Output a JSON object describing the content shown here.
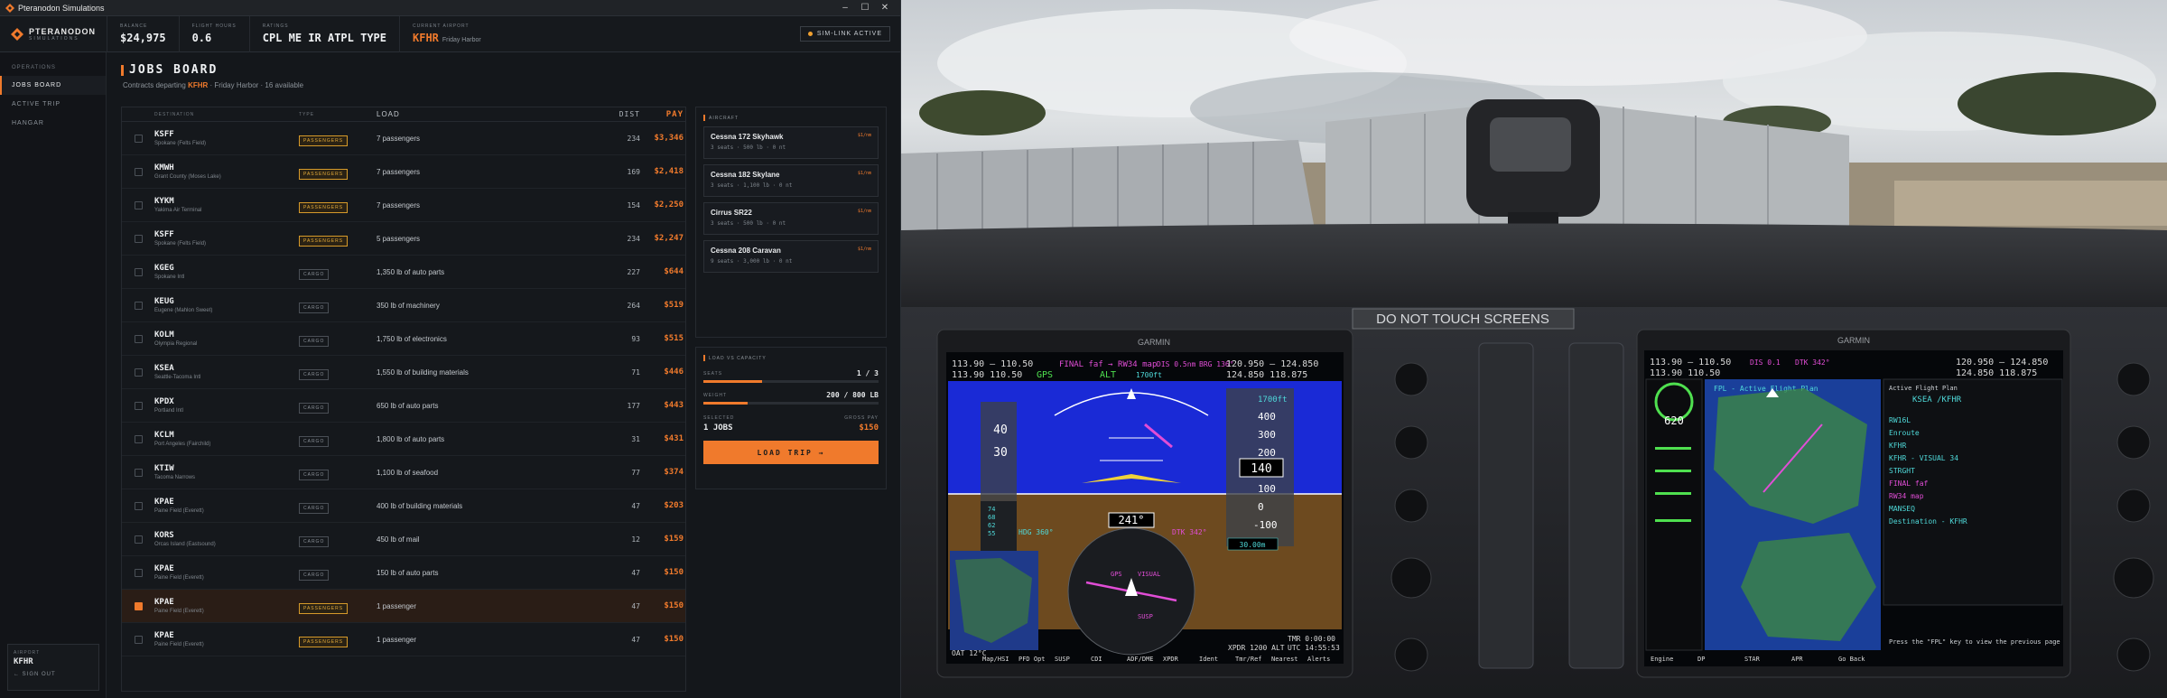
{
  "window": {
    "title": "Pteranodon Simulations",
    "controls": [
      "–",
      "☐",
      "✕"
    ]
  },
  "brand": {
    "name": "PTERANODON",
    "sub": "SIMULATIONS"
  },
  "stats": [
    {
      "label": "BALANCE",
      "value": "$24,975"
    },
    {
      "label": "FLIGHT HOURS",
      "value": "0.6"
    },
    {
      "label": "RATINGS",
      "value": "CPL ME IR ATPL TYPE"
    }
  ],
  "current_airport": {
    "label": "CURRENT AIRPORT",
    "icao": "KFHR",
    "name": "Friday Harbor"
  },
  "simlink": {
    "label": "SIM-LINK ACTIVE",
    "color": "#f0a030"
  },
  "sidebar": {
    "section": "OPERATIONS",
    "items": [
      {
        "label": "JOBS BOARD",
        "active": true
      },
      {
        "label": "ACTIVE TRIP",
        "active": false
      },
      {
        "label": "HANGAR",
        "active": false
      }
    ],
    "footer": {
      "label": "AIRPORT",
      "value": "KFHR",
      "signout": "← SIGN OUT"
    }
  },
  "page": {
    "title": "JOBS BOARD",
    "subtitle_prefix": "Contracts departing",
    "subtitle_icao": "KFHR",
    "subtitle_suffix": "· Friday Harbor · 16 available"
  },
  "jobs": {
    "columns": [
      "DESTINATION",
      "TYPE",
      "LOAD",
      "DIST",
      "PAY"
    ],
    "rows": [
      {
        "icao": "KSFF",
        "name": "Spokane (Felts Field)",
        "type": "PASSENGERS",
        "load": "7 passengers",
        "dist": "234",
        "pay": "$3,346",
        "selected": false
      },
      {
        "icao": "KMWH",
        "name": "Grant County (Moses Lake)",
        "type": "PASSENGERS",
        "load": "7 passengers",
        "dist": "169",
        "pay": "$2,418",
        "selected": false
      },
      {
        "icao": "KYKM",
        "name": "Yakima Air Terminal",
        "type": "PASSENGERS",
        "load": "7 passengers",
        "dist": "154",
        "pay": "$2,250",
        "selected": false
      },
      {
        "icao": "KSFF",
        "name": "Spokane (Felts Field)",
        "type": "PASSENGERS",
        "load": "5 passengers",
        "dist": "234",
        "pay": "$2,247",
        "selected": false
      },
      {
        "icao": "KGEG",
        "name": "Spokane Intl",
        "type": "CARGO",
        "load": "1,350 lb of auto parts",
        "dist": "227",
        "pay": "$644",
        "selected": false
      },
      {
        "icao": "KEUG",
        "name": "Eugene (Mahlon Sweet)",
        "type": "CARGO",
        "load": "350 lb of machinery",
        "dist": "264",
        "pay": "$519",
        "selected": false
      },
      {
        "icao": "KOLM",
        "name": "Olympia Regional",
        "type": "CARGO",
        "load": "1,750 lb of electronics",
        "dist": "93",
        "pay": "$515",
        "selected": false
      },
      {
        "icao": "KSEA",
        "name": "Seattle-Tacoma Intl",
        "type": "CARGO",
        "load": "1,550 lb of building materials",
        "dist": "71",
        "pay": "$446",
        "selected": false
      },
      {
        "icao": "KPDX",
        "name": "Portland Intl",
        "type": "CARGO",
        "load": "650 lb of auto parts",
        "dist": "177",
        "pay": "$443",
        "selected": false
      },
      {
        "icao": "KCLM",
        "name": "Port Angeles (Fairchild)",
        "type": "CARGO",
        "load": "1,800 lb of auto parts",
        "dist": "31",
        "pay": "$431",
        "selected": false
      },
      {
        "icao": "KTIW",
        "name": "Tacoma Narrows",
        "type": "CARGO",
        "load": "1,100 lb of seafood",
        "dist": "77",
        "pay": "$374",
        "selected": false
      },
      {
        "icao": "KPAE",
        "name": "Paine Field (Everett)",
        "type": "CARGO",
        "load": "400 lb of building materials",
        "dist": "47",
        "pay": "$203",
        "selected": false
      },
      {
        "icao": "KORS",
        "name": "Orcas Island (Eastsound)",
        "type": "CARGO",
        "load": "450 lb of mail",
        "dist": "12",
        "pay": "$159",
        "selected": false
      },
      {
        "icao": "KPAE",
        "name": "Paine Field (Everett)",
        "type": "CARGO",
        "load": "150 lb of auto parts",
        "dist": "47",
        "pay": "$150",
        "selected": false
      },
      {
        "icao": "KPAE",
        "name": "Paine Field (Everett)",
        "type": "PASSENGERS",
        "load": "1 passenger",
        "dist": "47",
        "pay": "$150",
        "selected": true
      },
      {
        "icao": "KPAE",
        "name": "Paine Field (Everett)",
        "type": "PASSENGERS",
        "load": "1 passenger",
        "dist": "47",
        "pay": "$150",
        "selected": false
      }
    ]
  },
  "aircraft": {
    "header": "AIRCRAFT",
    "items": [
      {
        "name": "Cessna 172 Skyhawk",
        "spec": "3 seats · 500 lb · 0 nt",
        "rate": "$1/nm"
      },
      {
        "name": "Cessna 182 Skylane",
        "spec": "3 seats · 1,100 lb · 0 nt",
        "rate": "$1/nm"
      },
      {
        "name": "Cirrus SR22",
        "spec": "3 seats · 500 lb · 0 nt",
        "rate": "$1/nm"
      },
      {
        "name": "Cessna 208 Caravan",
        "spec": "9 seats · 3,000 lb · 0 nt",
        "rate": "$1/nm"
      }
    ]
  },
  "capacity": {
    "header": "LOAD vs CAPACITY",
    "seats_label": "SEATS",
    "seats_value": "1 / 3",
    "seats_frac": 0.333,
    "weight_label": "WEIGHT",
    "weight_value": "200 / 800 lb",
    "weight_frac": 0.25,
    "selected_label": "SELECTED",
    "gross_label": "GROSS PAY",
    "selected_value": "1 JOBS",
    "gross_value": "$150",
    "button": "LOAD TRIP →"
  },
  "colors": {
    "accent": "#f07a2c",
    "pax_tag": "#e6ac3a"
  },
  "sim": {
    "placard": "DO NOT TOUCH SCREENS",
    "brand": "GARMIN",
    "pfd": {
      "freqs_left": "113.90 — 110.50",
      "freqs_left2": "113.90   110.50",
      "nav_msg": "FINAL faf → RW34 map",
      "dis": "DIS 0.5nm",
      "brg": "BRG 136°",
      "gps": "GPS",
      "alt_mode": "ALT",
      "alt_sel": "1700ft",
      "com1": "120.950 — 124.850",
      "com2": "124.850   118.875",
      "hdg": "HDG 360°",
      "track": "241°",
      "dtk": "DTK 342°",
      "xpdr": "XPDR 1200 ALT",
      "tmr": "TMR 0:00:00",
      "utc": "UTC 14:55:53",
      "oat": "OAT 12°C",
      "softkeys": [
        "Map/HSI",
        "PFD Opt",
        "SUSP",
        "CDI",
        "ADF/DME",
        "XPDR",
        "Ident",
        "Tmr/Ref",
        "Nearest",
        "Alerts"
      ],
      "vs_box": "30.00m",
      "alt_box": "140"
    },
    "mfd": {
      "freqs_left": "113.90 — 110.50",
      "freqs_left2": "113.90   110.50",
      "dis": "DIS 0.1",
      "dtk": "DTK 342°",
      "com1": "120.950 — 124.850",
      "com2": "124.850   118.875",
      "map_title": "FPL - Active Flight Plan",
      "fpl_title": "Active Flight Plan",
      "fpl_route": "KSEA /KFHR",
      "fpl_rows": [
        "RW16L",
        "Enroute",
        "KFHR",
        "KFHR - VISUAL 34",
        "STRGHT",
        "FINAL faf",
        "RW34 map",
        "MANSEQ",
        "Destination - KFHR"
      ],
      "rpm": "620",
      "hint": "Press the \"FPL\" key to view the previous page",
      "softkeys": [
        "Engine",
        "DP",
        "STAR",
        "APR",
        "Go Back"
      ]
    }
  }
}
